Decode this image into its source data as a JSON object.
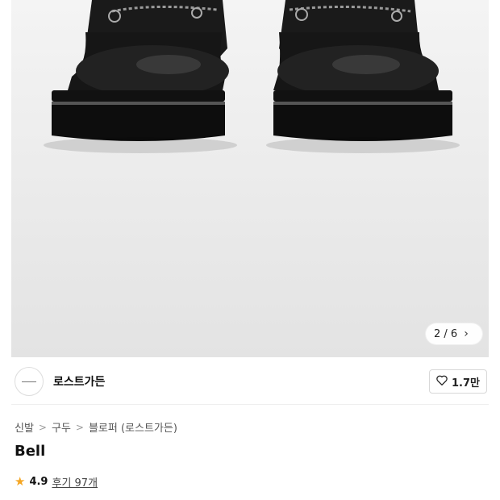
{
  "gallery": {
    "image_alt_icon": "shoe-product-image",
    "counter_text": "2 / 6",
    "next_icon": "chevron-right-icon"
  },
  "brand": {
    "name": "로스트가든",
    "like_count": "1.7만",
    "like_icon": "heart-icon"
  },
  "breadcrumb": {
    "items": [
      "신발",
      "구두",
      "블로퍼 (로스트가든)"
    ],
    "separator": ">"
  },
  "product": {
    "title": "Bell",
    "rating": "4.9",
    "review_text": "후기 97개",
    "star_color": "#f5a623"
  }
}
